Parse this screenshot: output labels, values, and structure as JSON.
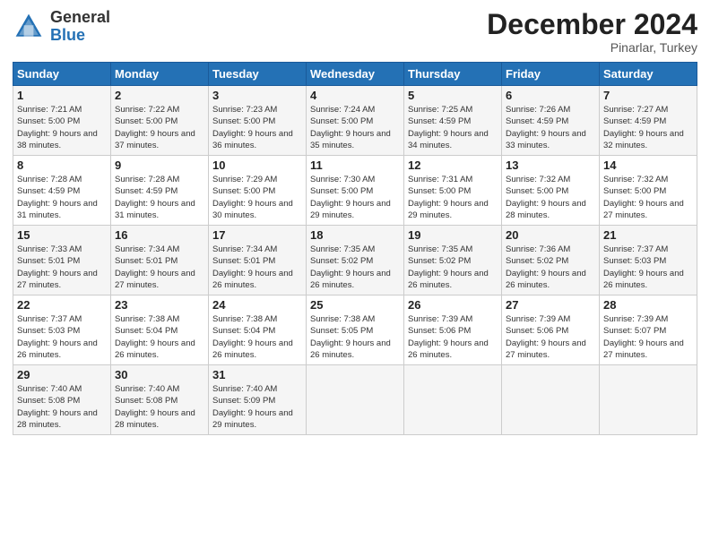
{
  "header": {
    "logo_general": "General",
    "logo_blue": "Blue",
    "month_year": "December 2024",
    "location": "Pinarlar, Turkey"
  },
  "weekdays": [
    "Sunday",
    "Monday",
    "Tuesday",
    "Wednesday",
    "Thursday",
    "Friday",
    "Saturday"
  ],
  "weeks": [
    [
      {
        "day": "1",
        "sunrise": "Sunrise: 7:21 AM",
        "sunset": "Sunset: 5:00 PM",
        "daylight": "Daylight: 9 hours and 38 minutes."
      },
      {
        "day": "2",
        "sunrise": "Sunrise: 7:22 AM",
        "sunset": "Sunset: 5:00 PM",
        "daylight": "Daylight: 9 hours and 37 minutes."
      },
      {
        "day": "3",
        "sunrise": "Sunrise: 7:23 AM",
        "sunset": "Sunset: 5:00 PM",
        "daylight": "Daylight: 9 hours and 36 minutes."
      },
      {
        "day": "4",
        "sunrise": "Sunrise: 7:24 AM",
        "sunset": "Sunset: 5:00 PM",
        "daylight": "Daylight: 9 hours and 35 minutes."
      },
      {
        "day": "5",
        "sunrise": "Sunrise: 7:25 AM",
        "sunset": "Sunset: 4:59 PM",
        "daylight": "Daylight: 9 hours and 34 minutes."
      },
      {
        "day": "6",
        "sunrise": "Sunrise: 7:26 AM",
        "sunset": "Sunset: 4:59 PM",
        "daylight": "Daylight: 9 hours and 33 minutes."
      },
      {
        "day": "7",
        "sunrise": "Sunrise: 7:27 AM",
        "sunset": "Sunset: 4:59 PM",
        "daylight": "Daylight: 9 hours and 32 minutes."
      }
    ],
    [
      {
        "day": "8",
        "sunrise": "Sunrise: 7:28 AM",
        "sunset": "Sunset: 4:59 PM",
        "daylight": "Daylight: 9 hours and 31 minutes."
      },
      {
        "day": "9",
        "sunrise": "Sunrise: 7:28 AM",
        "sunset": "Sunset: 4:59 PM",
        "daylight": "Daylight: 9 hours and 31 minutes."
      },
      {
        "day": "10",
        "sunrise": "Sunrise: 7:29 AM",
        "sunset": "Sunset: 5:00 PM",
        "daylight": "Daylight: 9 hours and 30 minutes."
      },
      {
        "day": "11",
        "sunrise": "Sunrise: 7:30 AM",
        "sunset": "Sunset: 5:00 PM",
        "daylight": "Daylight: 9 hours and 29 minutes."
      },
      {
        "day": "12",
        "sunrise": "Sunrise: 7:31 AM",
        "sunset": "Sunset: 5:00 PM",
        "daylight": "Daylight: 9 hours and 29 minutes."
      },
      {
        "day": "13",
        "sunrise": "Sunrise: 7:32 AM",
        "sunset": "Sunset: 5:00 PM",
        "daylight": "Daylight: 9 hours and 28 minutes."
      },
      {
        "day": "14",
        "sunrise": "Sunrise: 7:32 AM",
        "sunset": "Sunset: 5:00 PM",
        "daylight": "Daylight: 9 hours and 27 minutes."
      }
    ],
    [
      {
        "day": "15",
        "sunrise": "Sunrise: 7:33 AM",
        "sunset": "Sunset: 5:01 PM",
        "daylight": "Daylight: 9 hours and 27 minutes."
      },
      {
        "day": "16",
        "sunrise": "Sunrise: 7:34 AM",
        "sunset": "Sunset: 5:01 PM",
        "daylight": "Daylight: 9 hours and 27 minutes."
      },
      {
        "day": "17",
        "sunrise": "Sunrise: 7:34 AM",
        "sunset": "Sunset: 5:01 PM",
        "daylight": "Daylight: 9 hours and 26 minutes."
      },
      {
        "day": "18",
        "sunrise": "Sunrise: 7:35 AM",
        "sunset": "Sunset: 5:02 PM",
        "daylight": "Daylight: 9 hours and 26 minutes."
      },
      {
        "day": "19",
        "sunrise": "Sunrise: 7:35 AM",
        "sunset": "Sunset: 5:02 PM",
        "daylight": "Daylight: 9 hours and 26 minutes."
      },
      {
        "day": "20",
        "sunrise": "Sunrise: 7:36 AM",
        "sunset": "Sunset: 5:02 PM",
        "daylight": "Daylight: 9 hours and 26 minutes."
      },
      {
        "day": "21",
        "sunrise": "Sunrise: 7:37 AM",
        "sunset": "Sunset: 5:03 PM",
        "daylight": "Daylight: 9 hours and 26 minutes."
      }
    ],
    [
      {
        "day": "22",
        "sunrise": "Sunrise: 7:37 AM",
        "sunset": "Sunset: 5:03 PM",
        "daylight": "Daylight: 9 hours and 26 minutes."
      },
      {
        "day": "23",
        "sunrise": "Sunrise: 7:38 AM",
        "sunset": "Sunset: 5:04 PM",
        "daylight": "Daylight: 9 hours and 26 minutes."
      },
      {
        "day": "24",
        "sunrise": "Sunrise: 7:38 AM",
        "sunset": "Sunset: 5:04 PM",
        "daylight": "Daylight: 9 hours and 26 minutes."
      },
      {
        "day": "25",
        "sunrise": "Sunrise: 7:38 AM",
        "sunset": "Sunset: 5:05 PM",
        "daylight": "Daylight: 9 hours and 26 minutes."
      },
      {
        "day": "26",
        "sunrise": "Sunrise: 7:39 AM",
        "sunset": "Sunset: 5:06 PM",
        "daylight": "Daylight: 9 hours and 26 minutes."
      },
      {
        "day": "27",
        "sunrise": "Sunrise: 7:39 AM",
        "sunset": "Sunset: 5:06 PM",
        "daylight": "Daylight: 9 hours and 27 minutes."
      },
      {
        "day": "28",
        "sunrise": "Sunrise: 7:39 AM",
        "sunset": "Sunset: 5:07 PM",
        "daylight": "Daylight: 9 hours and 27 minutes."
      }
    ],
    [
      {
        "day": "29",
        "sunrise": "Sunrise: 7:40 AM",
        "sunset": "Sunset: 5:08 PM",
        "daylight": "Daylight: 9 hours and 28 minutes."
      },
      {
        "day": "30",
        "sunrise": "Sunrise: 7:40 AM",
        "sunset": "Sunset: 5:08 PM",
        "daylight": "Daylight: 9 hours and 28 minutes."
      },
      {
        "day": "31",
        "sunrise": "Sunrise: 7:40 AM",
        "sunset": "Sunset: 5:09 PM",
        "daylight": "Daylight: 9 hours and 29 minutes."
      },
      null,
      null,
      null,
      null
    ]
  ]
}
